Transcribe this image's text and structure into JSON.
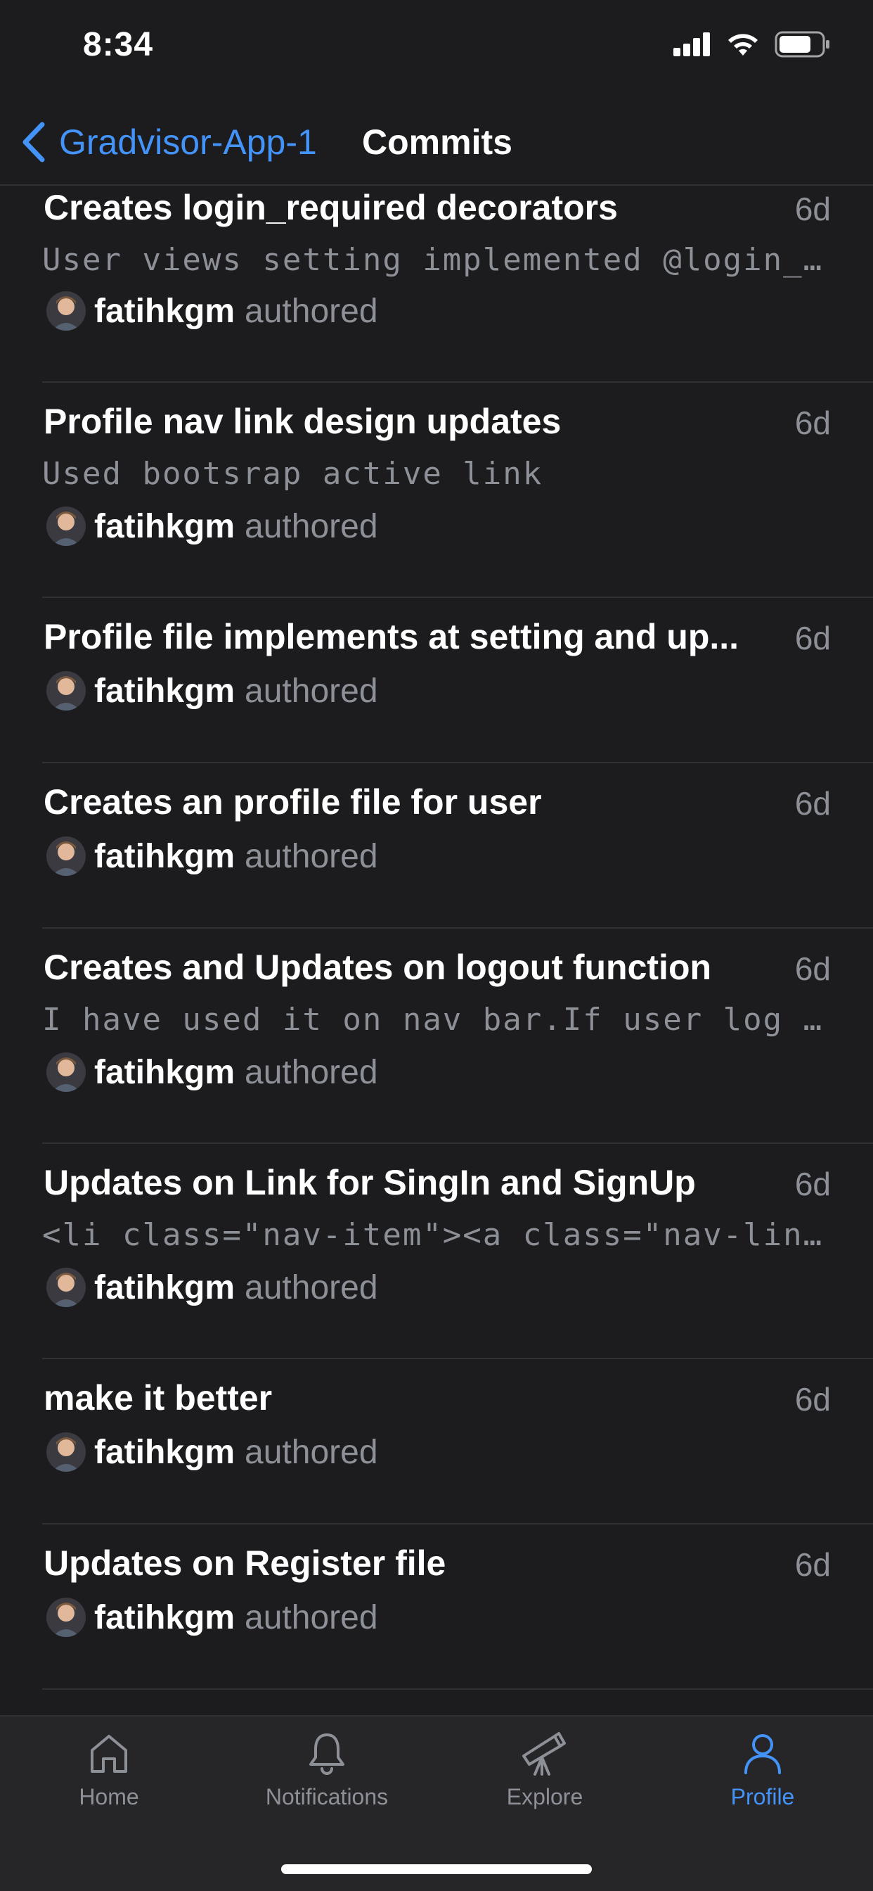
{
  "status": {
    "time": "8:34"
  },
  "nav": {
    "back_label": "Gradvisor-App-1",
    "title": "Commits"
  },
  "commits": [
    {
      "title": "Creates login_required decorators",
      "message": "User views setting implemented  @login_…",
      "author": "fatihkgm",
      "verb": "authored",
      "age": "6d"
    },
    {
      "title": "Profile nav link design updates",
      "message": "Used bootsrap active link",
      "author": "fatihkgm",
      "verb": "authored",
      "age": "6d"
    },
    {
      "title": "Profile file implements at setting and up...",
      "author": "fatihkgm",
      "verb": "authored",
      "age": "6d"
    },
    {
      "title": "Creates an profile file for user",
      "author": "fatihkgm",
      "verb": "authored",
      "age": "6d"
    },
    {
      "title": "Creates and Updates on logout function",
      "message": "I have used it on nav bar.If user log i…",
      "author": "fatihkgm",
      "verb": "authored",
      "age": "6d"
    },
    {
      "title": "Updates on Link for SingIn and SignUp",
      "message": "<li class=\"nav-item\"><a class=\"nav-link…",
      "author": "fatihkgm",
      "verb": "authored",
      "age": "6d"
    },
    {
      "title": "make it better",
      "author": "fatihkgm",
      "verb": "authored",
      "age": "6d"
    },
    {
      "title": "Updates on Register file",
      "author": "fatihkgm",
      "verb": "authored",
      "age": "6d"
    }
  ],
  "tabs": [
    {
      "label": "Home",
      "icon": "home-icon"
    },
    {
      "label": "Notifications",
      "icon": "bell-icon"
    },
    {
      "label": "Explore",
      "icon": "telescope-icon"
    },
    {
      "label": "Profile",
      "icon": "person-icon"
    }
  ],
  "colors": {
    "accent": "#4493f8",
    "background": "#1c1c1f",
    "muted": "#8d9096",
    "tabbar": "#262629"
  }
}
